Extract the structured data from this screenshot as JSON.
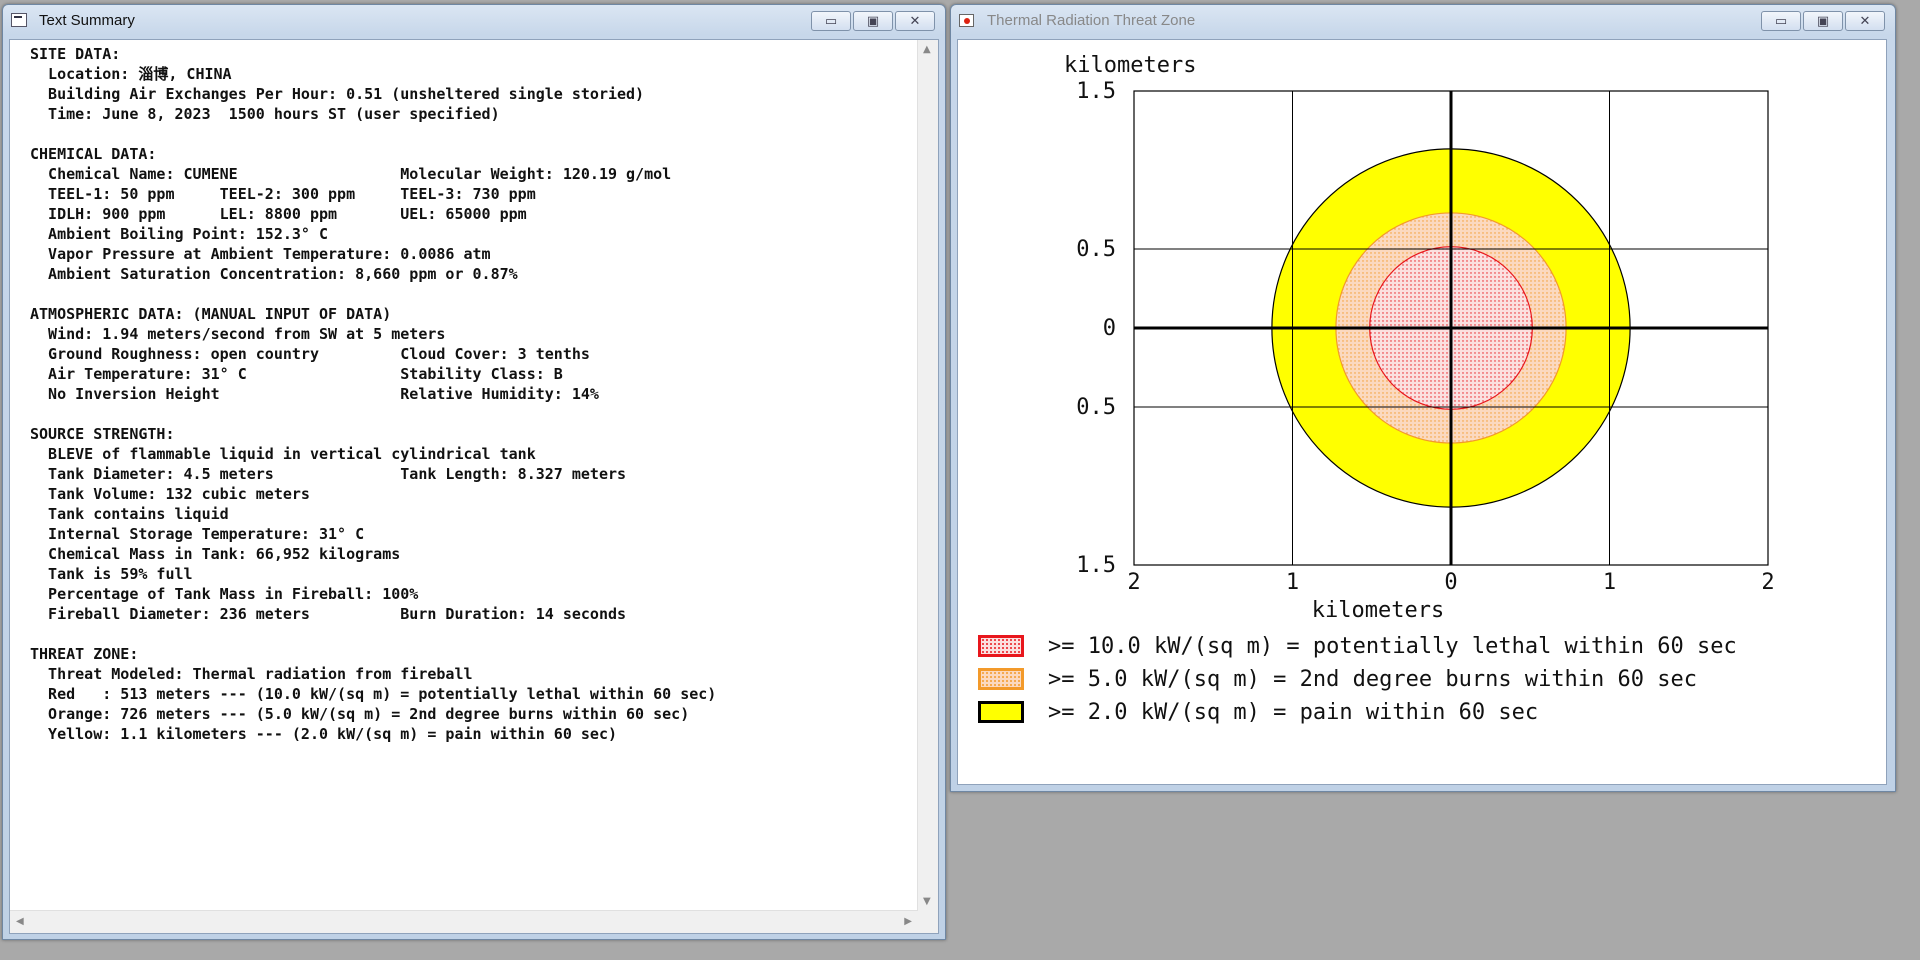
{
  "text_summary_window": {
    "title": "Text Summary",
    "buttons": {
      "minimize": "▭",
      "maximize": "▣",
      "close": "✕"
    },
    "lines": [
      "SITE DATA:",
      "  Location: 淄博, CHINA",
      "  Building Air Exchanges Per Hour: 0.51 (unsheltered single storied)",
      "  Time: June 8, 2023  1500 hours ST (user specified)",
      "",
      "CHEMICAL DATA:",
      "  Chemical Name: CUMENE                  Molecular Weight: 120.19 g/mol",
      "  TEEL-1: 50 ppm     TEEL-2: 300 ppm     TEEL-3: 730 ppm",
      "  IDLH: 900 ppm      LEL: 8800 ppm       UEL: 65000 ppm",
      "  Ambient Boiling Point: 152.3° C",
      "  Vapor Pressure at Ambient Temperature: 0.0086 atm",
      "  Ambient Saturation Concentration: 8,660 ppm or 0.87%",
      "",
      "ATMOSPHERIC DATA: (MANUAL INPUT OF DATA)",
      "  Wind: 1.94 meters/second from SW at 5 meters",
      "  Ground Roughness: open country         Cloud Cover: 3 tenths",
      "  Air Temperature: 31° C                 Stability Class: B",
      "  No Inversion Height                    Relative Humidity: 14%",
      "",
      "SOURCE STRENGTH:",
      "  BLEVE of flammable liquid in vertical cylindrical tank",
      "  Tank Diameter: 4.5 meters              Tank Length: 8.327 meters",
      "  Tank Volume: 132 cubic meters",
      "  Tank contains liquid",
      "  Internal Storage Temperature: 31° C",
      "  Chemical Mass in Tank: 66,952 kilograms",
      "  Tank is 59% full",
      "  Percentage of Tank Mass in Fireball: 100%",
      "  Fireball Diameter: 236 meters          Burn Duration: 14 seconds",
      "",
      "THREAT ZONE:",
      "  Threat Modeled: Thermal radiation from fireball",
      "  Red   : 513 meters --- (10.0 kW/(sq m) = potentially lethal within 60 sec)",
      "  Orange: 726 meters --- (5.0 kW/(sq m) = 2nd degree burns within 60 sec)",
      "  Yellow: 1.1 kilometers --- (2.0 kW/(sq m) = pain within 60 sec)"
    ]
  },
  "threat_zone_window": {
    "title": "Thermal Radiation Threat Zone",
    "buttons": {
      "minimize": "▭",
      "maximize": "▣",
      "close": "✕"
    },
    "plot": {
      "y_unit_label": "kilometers",
      "x_unit_label": "kilometers",
      "y_tick_labels": [
        "1.5",
        "0.5",
        "0",
        "0.5",
        "1.5"
      ],
      "x_tick_labels": [
        "2",
        "1",
        "0",
        "1",
        "2"
      ]
    },
    "legend": [
      {
        "text": ">= 10.0 kW/(sq m) = potentially lethal within 60 sec",
        "border": "#e8161c",
        "fill": "#fbe0e0"
      },
      {
        "text": ">= 5.0 kW/(sq m) = 2nd degree burns within 60 sec",
        "border": "#f39a2a",
        "fill": "#fbd9c0"
      },
      {
        "text": ">= 2.0 kW/(sq m) = pain within 60 sec",
        "border": "#000000",
        "fill": "#ffff00"
      }
    ]
  },
  "chart_data": {
    "type": "threat-zone-map",
    "x_range_km": [
      -2,
      2
    ],
    "y_range_km": [
      -1.5,
      1.5
    ],
    "zones": [
      {
        "name": "Yellow",
        "radius_km": 1.13,
        "color": "#ffff00",
        "stroke": "#000000"
      },
      {
        "name": "Orange",
        "radius_km": 0.726,
        "color": "#fbd9c0",
        "stroke": "#f39a2a"
      },
      {
        "name": "Red",
        "radius_km": 0.513,
        "color": "#fbe0e0",
        "stroke": "#e8161c"
      }
    ],
    "grid": true
  }
}
